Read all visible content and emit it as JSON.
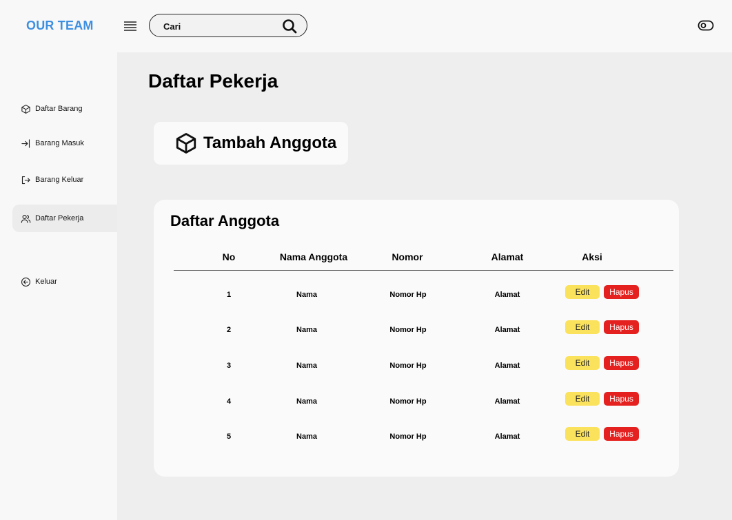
{
  "header": {
    "brand": "OUR TEAM",
    "search_placeholder": "Cari"
  },
  "sidebar": {
    "items": [
      {
        "label": "Daftar Barang",
        "icon": "box-icon",
        "active": false
      },
      {
        "label": "Barang Masuk",
        "icon": "arrow-in-icon",
        "active": false
      },
      {
        "label": "Barang Keluar",
        "icon": "exit-icon",
        "active": false
      },
      {
        "label": "Daftar Pekerja",
        "icon": "users-icon",
        "active": true
      }
    ],
    "logout": {
      "label": "Keluar",
      "icon": "back-circle-icon"
    }
  },
  "main": {
    "title": "Daftar Pekerja",
    "add_button": "Tambah Anggota",
    "list_title": "Daftar Anggota",
    "columns": [
      "No",
      "Nama Anggota",
      "Nomor",
      "Alamat",
      "Aksi"
    ],
    "rows": [
      {
        "no": "1",
        "nama": "Nama",
        "nomor": "Nomor Hp",
        "alamat": "Alamat"
      },
      {
        "no": "2",
        "nama": "Nama",
        "nomor": "Nomor Hp",
        "alamat": "Alamat"
      },
      {
        "no": "3",
        "nama": "Nama",
        "nomor": "Nomor Hp",
        "alamat": "Alamat"
      },
      {
        "no": "4",
        "nama": "Nama",
        "nomor": "Nomor Hp",
        "alamat": "Alamat"
      },
      {
        "no": "5",
        "nama": "Nama",
        "nomor": "Nomor Hp",
        "alamat": "Alamat"
      }
    ],
    "edit_label": "Edit",
    "delete_label": "Hapus"
  },
  "colors": {
    "brand": "#3d8fe0",
    "edit": "#fbe25c",
    "delete": "#e4211f"
  }
}
